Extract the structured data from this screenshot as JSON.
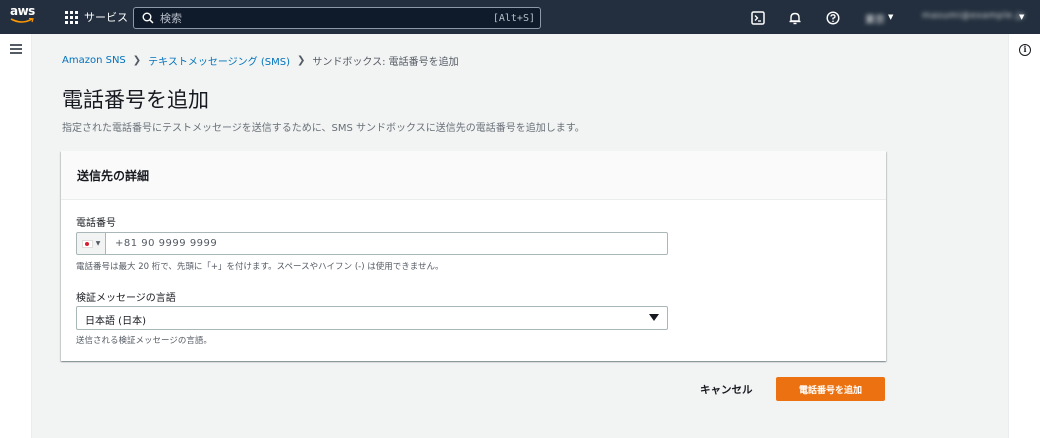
{
  "topnav": {
    "logo_text": "aws",
    "services_label": "サービス",
    "search_placeholder": "検索",
    "search_shortcut": "[Alt+S]",
    "region_label": "東京",
    "account_label": "masumi@example.jp"
  },
  "breadcrumb": {
    "items": [
      "Amazon SNS",
      "テキストメッセージング (SMS)"
    ],
    "current": "サンドボックス: 電話番号を追加"
  },
  "page": {
    "title": "電話番号を追加",
    "description": "指定された電話番号にテストメッセージを送信するために、SMS サンドボックスに送信先の電話番号を追加します。"
  },
  "panel": {
    "header": "送信先の詳細",
    "phone": {
      "label": "電話番号",
      "value": "+81 90 9999 9999",
      "hint": "電話番号は最大 20 桁で、先頭に「+」を付けます。スペースやハイフン (-) は使用できません。"
    },
    "language": {
      "label": "検証メッセージの言語",
      "selected": "日本語 (日本)",
      "hint": "送信される検証メッセージの言語。"
    }
  },
  "actions": {
    "cancel_label": "キャンセル",
    "submit_label": "電話番号を追加"
  },
  "colors": {
    "nav_bg": "#232f3e",
    "primary": "#ec7211",
    "link": "#0073bb"
  }
}
